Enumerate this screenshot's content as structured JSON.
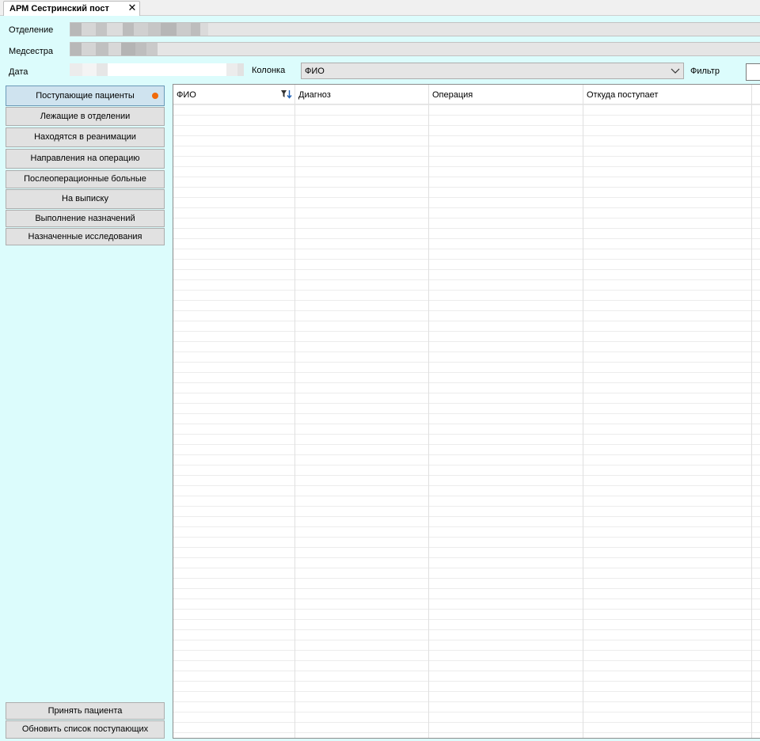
{
  "tab": {
    "title": "АРМ Сестринский пост",
    "close": "✕"
  },
  "form": {
    "department_label": "Отделение",
    "nurse_label": "Медсестра",
    "date_label": "Дата",
    "column_label": "Колонка",
    "column_value": "ФИО",
    "filter_label": "Фильтр"
  },
  "nav": {
    "incoming": "Поступающие пациенты",
    "in_department": "Лежащие в отделении",
    "icu": "Находятся в реанимации",
    "surgery_referrals": "Направления на операцию",
    "postop": "Послеоперационные больные",
    "discharge": "На выписку",
    "prescriptions": "Выполнение назначений",
    "studies": "Назначенные исследования",
    "accept_patient": "Принять пациента",
    "refresh_incoming": "Обновить список поступающих"
  },
  "grid": {
    "columns": [
      "ФИО",
      "Диагноз",
      "Операция",
      "Откуда поступает"
    ]
  },
  "colors": {
    "background": "#dcfcfc",
    "active_indicator": "#f06a0a"
  }
}
